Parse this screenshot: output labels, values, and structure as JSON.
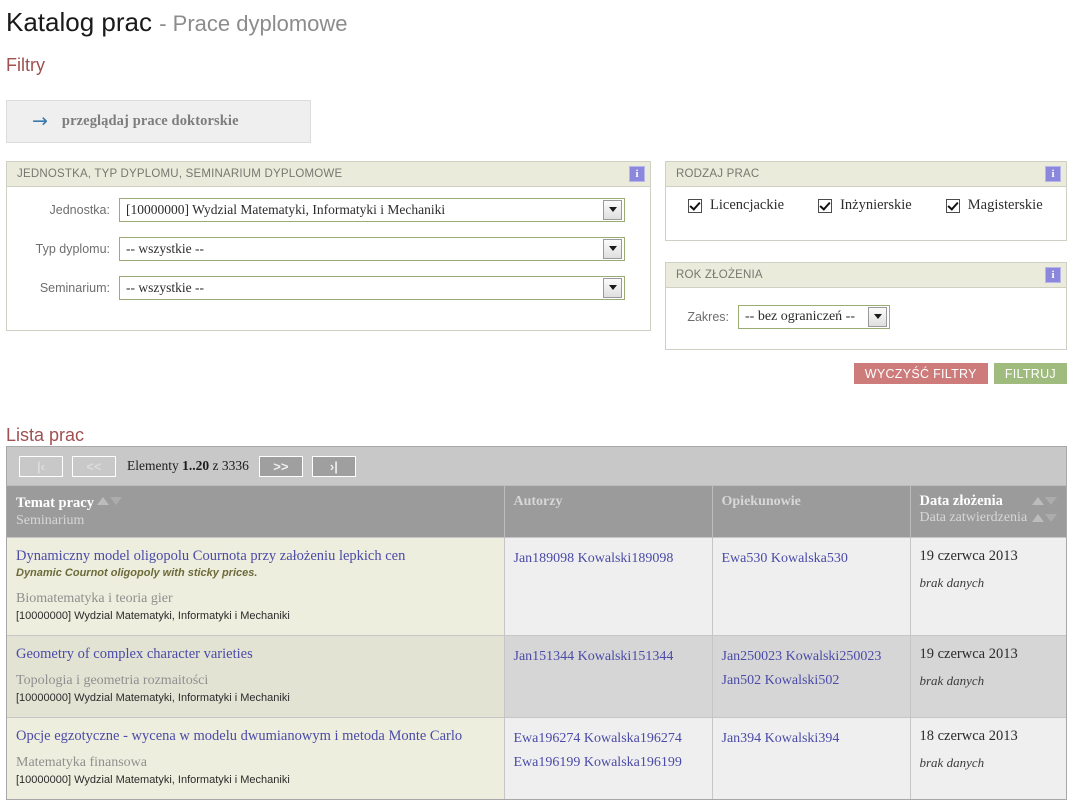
{
  "header": {
    "title": "Katalog prac",
    "subtitle": "- Prace dyplomowe"
  },
  "filters_section": {
    "title": "Filtry",
    "doctoral_button": {
      "arrow": "→",
      "label": "przeglądaj prace doktorskie"
    }
  },
  "panel_unit": {
    "title": "JEDNOSTKA, TYP DYPLOMU, SEMINARIUM DYPLOMOWE",
    "info_glyph": "i",
    "fields": [
      {
        "label": "Jednostka:",
        "value": "[10000000] Wydzial Matematyki, Informatyki i Mechaniki"
      },
      {
        "label": "Typ dyplomu:",
        "value": "-- wszystkie --"
      },
      {
        "label": "Seminarium:",
        "value": "-- wszystkie --"
      }
    ]
  },
  "panel_kind": {
    "title": "RODZAJ PRAC",
    "info_glyph": "i",
    "checkboxes": [
      {
        "label": "Licencjackie",
        "checked": true
      },
      {
        "label": "Inżynierskie",
        "checked": true
      },
      {
        "label": "Magisterskie",
        "checked": true
      }
    ]
  },
  "panel_year": {
    "title": "ROK ZŁOŻENIA",
    "info_glyph": "i",
    "field": {
      "label": "Zakres:",
      "value": "-- bez ograniczeń --"
    }
  },
  "actions": {
    "clear_label": "WYCZYŚĆ FILTRY",
    "filter_label": "FILTRUJ",
    "clear_color": "#cd7b7b",
    "filter_color": "#9fbb7e"
  },
  "list_section": {
    "title": "Lista prac"
  },
  "pager": {
    "first_label": "|‹",
    "prev_label": "<<",
    "next_label": ">>",
    "last_label": "›|",
    "info_prefix": "Elementy",
    "range": "1..20",
    "info_middle": "z",
    "total": "3336"
  },
  "table": {
    "columns": [
      {
        "main": "Temat pracy",
        "sub": "Seminarium",
        "sortable_main": true,
        "sortable_sub": false
      },
      {
        "main": "Autorzy",
        "sub": "",
        "sortable_main": false,
        "sortable_sub": false
      },
      {
        "main": "Opiekunowie",
        "sub": "",
        "sortable_main": false,
        "sortable_sub": false
      },
      {
        "main": "Data złożenia",
        "sub": "Data zatwierdzenia",
        "sortable_main": true,
        "sortable_sub": true
      }
    ],
    "rows": [
      {
        "title": "Dynamiczny model oligopolu Cournota przy założeniu lepkich cen",
        "alt_title": "Dynamic Cournot oligopoly with sticky prices.",
        "seminar": "Biomatematyka i teoria gier",
        "unit": "[10000000] Wydzial Matematyki, Informatyki i Mechaniki",
        "authors": [
          "Jan189098 Kowalski189098"
        ],
        "supervisors": [
          "Ewa530 Kowalska530"
        ],
        "date_submitted": "19 czerwca 2013",
        "date_approved": "brak danych"
      },
      {
        "title": "Geometry of complex character varieties",
        "alt_title": "",
        "seminar": "Topologia i geometria rozmaitości",
        "unit": "[10000000] Wydzial Matematyki, Informatyki i Mechaniki",
        "authors": [
          "Jan151344 Kowalski151344"
        ],
        "supervisors": [
          "Jan250023 Kowalski250023",
          "Jan502 Kowalski502"
        ],
        "date_submitted": "19 czerwca 2013",
        "date_approved": "brak danych"
      },
      {
        "title": "Opcje egzotyczne - wycena w modelu dwumianowym i metoda Monte Carlo",
        "alt_title": "",
        "seminar": "Matematyka finansowa",
        "unit": "[10000000] Wydzial Matematyki, Informatyki i Mechaniki",
        "authors": [
          "Ewa196274 Kowalska196274",
          "Ewa196199 Kowalska196199"
        ],
        "supervisors": [
          "Jan394 Kowalski394"
        ],
        "date_submitted": "18 czerwca 2013",
        "date_approved": "brak danych"
      }
    ]
  }
}
